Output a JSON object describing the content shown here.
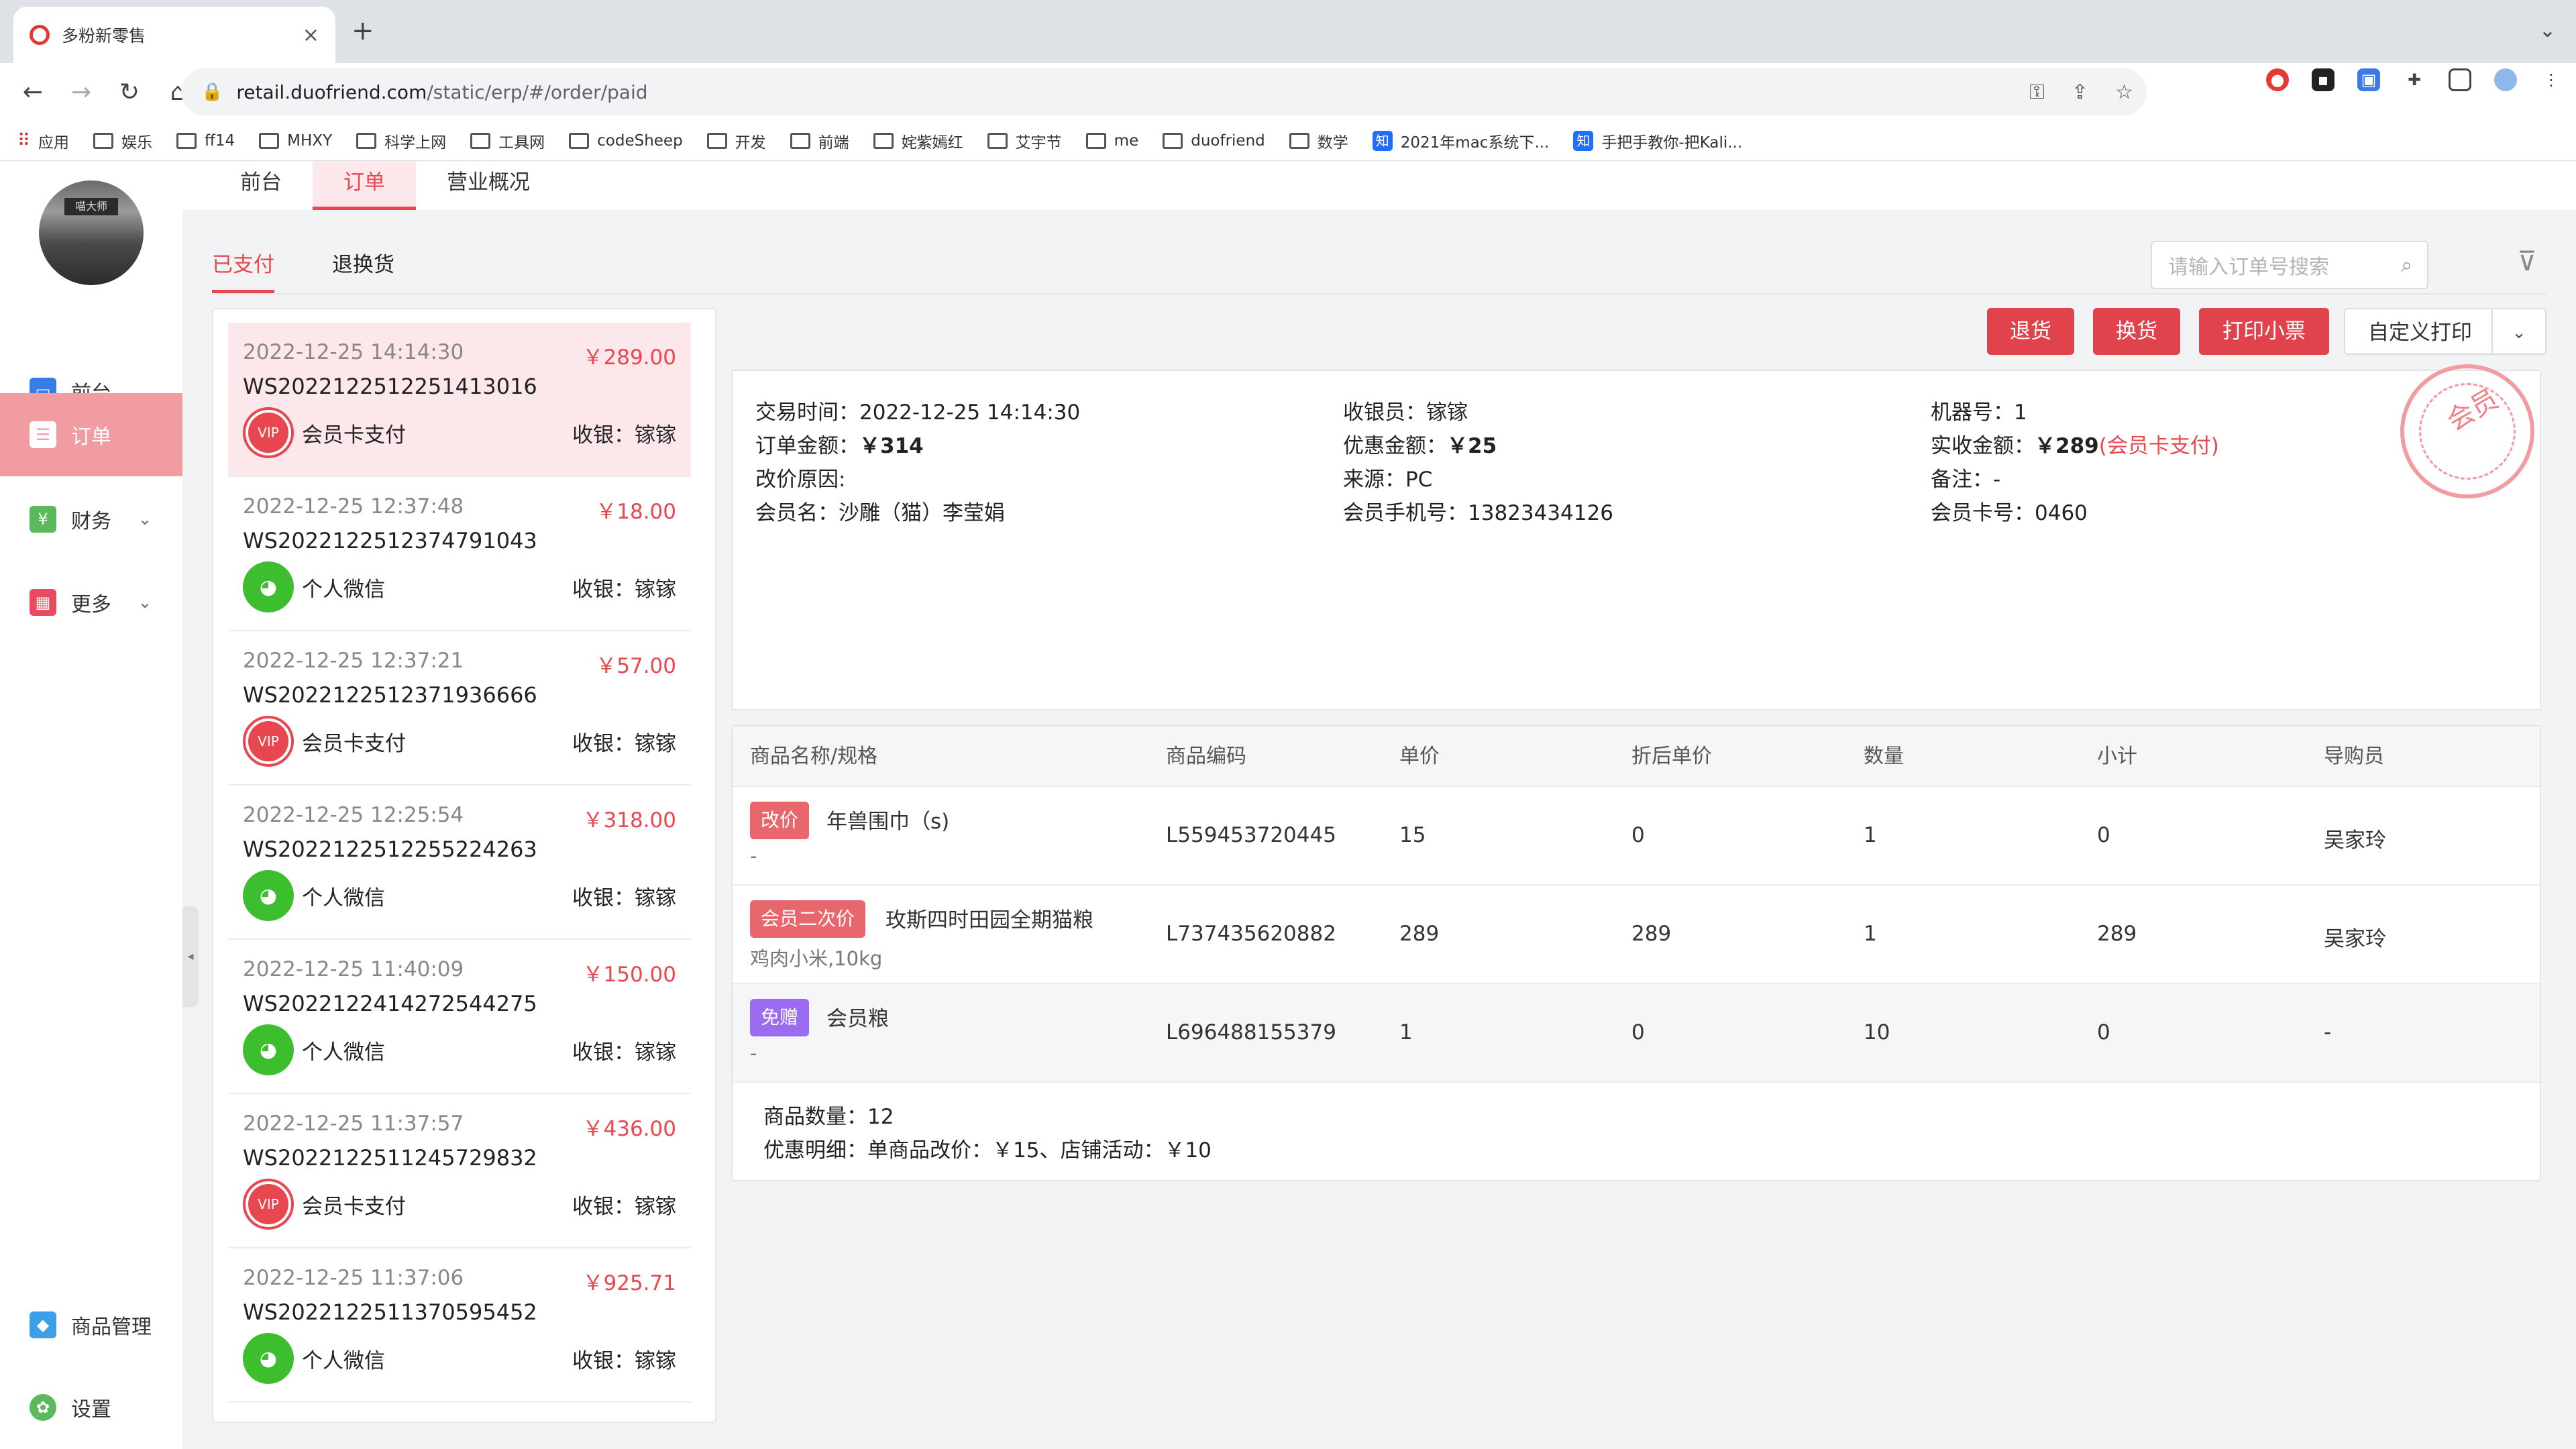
{
  "browser": {
    "tab_title": "多粉新零售",
    "url_domain": "retail.duofriend.com",
    "url_path": "/static/erp/#/order/paid",
    "bookmarks": [
      "应用",
      "娱乐",
      "ff14",
      "MHXY",
      "科学上网",
      "工具网",
      "codeSheep",
      "开发",
      "前端",
      "姹紫嫣红",
      "艾宇节",
      "me",
      "duofriend",
      "数学",
      "2021年mac系统下...",
      "手把手教你-把Kali..."
    ]
  },
  "sidebar": {
    "avatar_sign": "喵大师",
    "items": [
      {
        "label": "前台"
      },
      {
        "label": "订单"
      },
      {
        "label": "财务"
      },
      {
        "label": "更多"
      },
      {
        "label": "商品管理"
      },
      {
        "label": "设置"
      }
    ]
  },
  "topnav": [
    "前台",
    "订单",
    "营业概况"
  ],
  "subtabs": [
    "已支付",
    "退换货"
  ],
  "search": {
    "placeholder": "请输入订单号搜索"
  },
  "actions": {
    "return": "退货",
    "exchange": "换货",
    "print_receipt": "打印小票",
    "custom_print": "自定义打印"
  },
  "orders": [
    {
      "time": "2022-12-25 14:14:30",
      "amount": "￥289.00",
      "no": "WS2022122512251413016",
      "pay": "会员卡支付",
      "pay_type": "vip",
      "cashier": "收银：镓镓"
    },
    {
      "time": "2022-12-25 12:37:48",
      "amount": "￥18.00",
      "no": "WS2022122512374791043",
      "pay": "个人微信",
      "pay_type": "wechat",
      "cashier": "收银：镓镓"
    },
    {
      "time": "2022-12-25 12:37:21",
      "amount": "￥57.00",
      "no": "WS2022122512371936666",
      "pay": "会员卡支付",
      "pay_type": "vip",
      "cashier": "收银：镓镓"
    },
    {
      "time": "2022-12-25 12:25:54",
      "amount": "￥318.00",
      "no": "WS2022122512255224263",
      "pay": "个人微信",
      "pay_type": "wechat",
      "cashier": "收银：镓镓"
    },
    {
      "time": "2022-12-25 11:40:09",
      "amount": "￥150.00",
      "no": "WS2022122414272544275",
      "pay": "个人微信",
      "pay_type": "wechat",
      "cashier": "收银：镓镓"
    },
    {
      "time": "2022-12-25 11:37:57",
      "amount": "￥436.00",
      "no": "WS2022122511245729832",
      "pay": "会员卡支付",
      "pay_type": "vip",
      "cashier": "收银：镓镓"
    },
    {
      "time": "2022-12-25 11:37:06",
      "amount": "￥925.71",
      "no": "WS2022122511370595452",
      "pay": "个人微信",
      "pay_type": "wechat",
      "cashier": "收银：镓镓"
    }
  ],
  "detail": {
    "trade_time": "交易时间：2022-12-25 14:14:30",
    "cashier": "收银员：镓镓",
    "machine": "机器号：1",
    "order_amount_label": "订单金额：",
    "order_amount": "￥314",
    "discount_label": "优惠金额：",
    "discount": "￥25",
    "received_label": "实收金额：",
    "received": "￥289",
    "received_method": "(会员卡支付)",
    "reprice_reason": "改价原因:",
    "source": "来源：PC",
    "remark": "备注：-",
    "member_name": "会员名：沙雕（猫）李莹娟",
    "member_phone": "会员手机号：13823434126",
    "member_card": "会员卡号：0460",
    "stamp": "会员"
  },
  "table": {
    "headers": [
      "商品名称/规格",
      "商品编码",
      "单价",
      "折后单价",
      "数量",
      "小计",
      "导购员"
    ],
    "rows": [
      {
        "tag": "改价",
        "tag_color": "#e8676d",
        "name": "年兽围巾（s)",
        "spec": "-",
        "code": "L559453720445",
        "price": "15",
        "disc_price": "0",
        "qty": "1",
        "subtotal": "0",
        "guide": "吴家玲"
      },
      {
        "tag": "会员二次价",
        "tag_color": "#e8676d",
        "name": "玫斯四时田园全期猫粮",
        "spec": "鸡肉小米,10kg",
        "code": "L737435620882",
        "price": "289",
        "disc_price": "289",
        "qty": "1",
        "subtotal": "289",
        "guide": "吴家玲"
      },
      {
        "tag": "免赠",
        "tag_color": "#9c6cf0",
        "name": "会员粮",
        "spec": "-",
        "code": "L696488155379",
        "price": "1",
        "disc_price": "0",
        "qty": "10",
        "subtotal": "0",
        "guide": "-"
      }
    ],
    "summary_count": "商品数量：12",
    "summary_discount": "优惠明细：单商品改价：￥15、店铺活动：￥10"
  }
}
